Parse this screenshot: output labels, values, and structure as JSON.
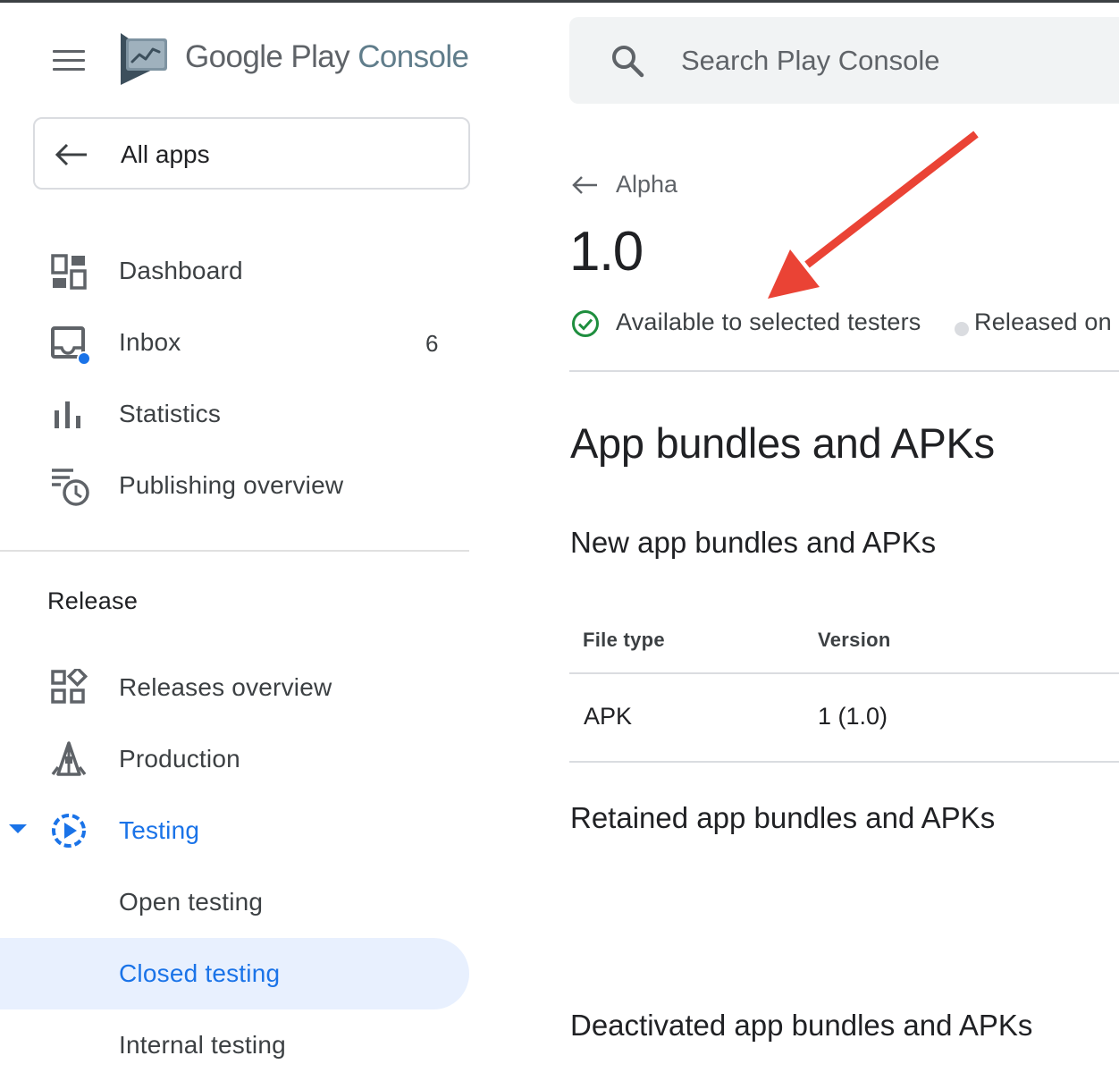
{
  "header": {
    "brand_google": "Google",
    "brand_play": "Play",
    "brand_console": "Console",
    "search_placeholder": "Search Play Console"
  },
  "sidebar": {
    "all_apps": "All apps",
    "items": [
      {
        "label": "Dashboard",
        "icon": "dashboard-icon"
      },
      {
        "label": "Inbox",
        "icon": "inbox-icon",
        "count": "6"
      },
      {
        "label": "Statistics",
        "icon": "statistics-icon"
      },
      {
        "label": "Publishing overview",
        "icon": "publishing-overview-icon"
      }
    ],
    "section_title": "Release",
    "release_items": [
      {
        "label": "Releases overview",
        "icon": "releases-overview-icon"
      },
      {
        "label": "Production",
        "icon": "production-icon"
      },
      {
        "label": "Testing",
        "icon": "testing-icon"
      }
    ],
    "testing_children": [
      {
        "label": "Open testing"
      },
      {
        "label": "Closed testing",
        "selected": true
      },
      {
        "label": "Internal testing"
      }
    ]
  },
  "main": {
    "back_label": "Alpha",
    "version": "1.0",
    "status": "Available to selected testers",
    "released": "Released on",
    "heading": "App bundles and APKs",
    "new_heading": "New app bundles and APKs",
    "table": {
      "columns": [
        "File type",
        "Version"
      ],
      "rows": [
        [
          "APK",
          "1 (1.0)"
        ]
      ]
    },
    "retained_heading": "Retained app bundles and APKs",
    "deactivated_heading": "Deactivated app bundles and APKs"
  },
  "colors": {
    "accent": "#1a73e8",
    "selected_bg": "#e8f0fe",
    "success": "#1e8e3e",
    "annotation_arrow": "#ea4335"
  }
}
